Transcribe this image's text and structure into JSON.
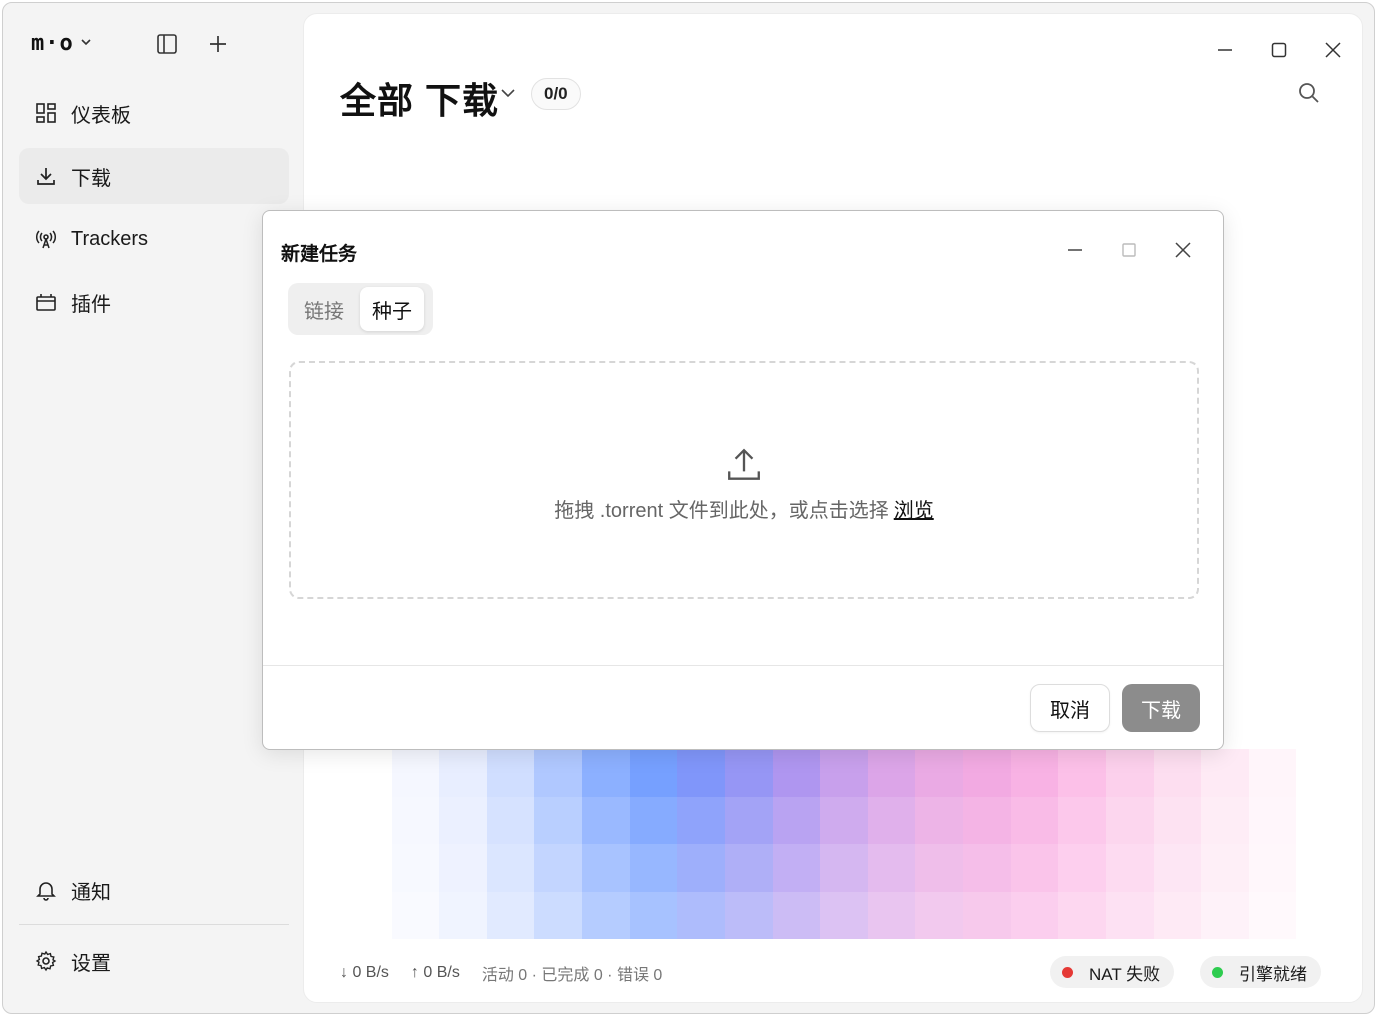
{
  "brand": {
    "logo_text": "m·o",
    "chevron": "⌄"
  },
  "sidebar": {
    "toggle_icon": "sidebar-icon",
    "add_icon": "plus-icon",
    "items": [
      {
        "label": "仪表板",
        "icon": "dashboard-icon",
        "active": false
      },
      {
        "label": "下载",
        "icon": "download-icon",
        "active": true
      },
      {
        "label": "Trackers",
        "icon": "antenna-icon",
        "active": false
      },
      {
        "label": "插件",
        "icon": "plugin-icon",
        "active": false
      }
    ],
    "bottom_items": [
      {
        "label": "通知",
        "icon": "bell-icon"
      },
      {
        "label": "设置",
        "icon": "gear-icon"
      }
    ]
  },
  "header": {
    "title": "全部 下载",
    "count": "0/0"
  },
  "dialog": {
    "title": "新建任务",
    "tabs": [
      {
        "label": "链接",
        "selected": false
      },
      {
        "label": "种子",
        "selected": true
      }
    ],
    "drop_text": "拖拽 .torrent 文件到此处，或点击选择",
    "browse_label": "浏览",
    "cancel_label": "取消",
    "download_label": "下载"
  },
  "status": {
    "down_speed": "↓ 0 B/s",
    "up_speed": "↑ 0 B/s",
    "summary": "活动 0 · 已完成 0 · 错误 0",
    "nat_label": "NAT 失败",
    "engine_label": "引擎就绪",
    "nat_color": "#e53935",
    "engine_color": "#2ecc4f"
  },
  "colors": {
    "accent_disabled": "#8c8c8c"
  }
}
